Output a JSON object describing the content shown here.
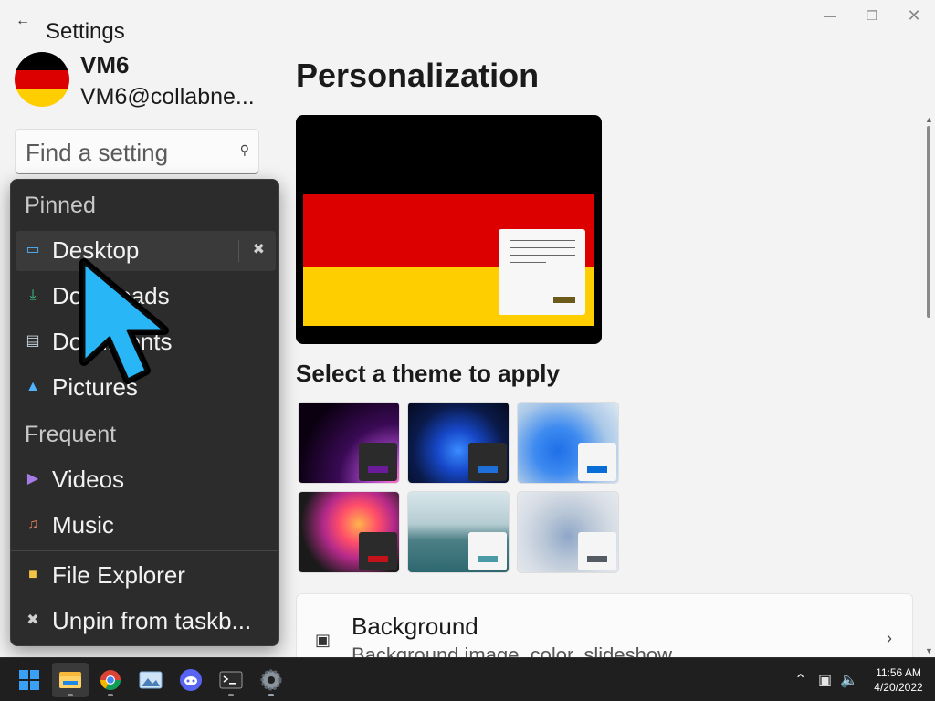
{
  "window": {
    "app_title": "Settings",
    "back_icon": "back-arrow-icon",
    "controls": [
      "minimize",
      "restore",
      "close"
    ]
  },
  "user": {
    "name": "VM6",
    "email": "VM6@collabne..."
  },
  "search": {
    "placeholder": "Find a setting"
  },
  "page": {
    "title": "Personalization",
    "theme_section_title": "Select a theme to apply",
    "themes": [
      {
        "name": "theme-1",
        "accent": "#6a1b9a"
      },
      {
        "name": "theme-2",
        "accent": "#1e6fd9"
      },
      {
        "name": "theme-3",
        "accent": "#0a6cd6"
      },
      {
        "name": "theme-4",
        "accent": "#c4121a"
      },
      {
        "name": "theme-5",
        "accent": "#4a9aa8"
      },
      {
        "name": "theme-6",
        "accent": "#555b63"
      }
    ],
    "background_card": {
      "title": "Background",
      "subtitle": "Background image, color, slideshow"
    }
  },
  "jump_list": {
    "pinned_header": "Pinned",
    "pinned": [
      {
        "label": "Desktop",
        "icon": "desktop-icon"
      },
      {
        "label": "Downloads",
        "icon": "download-icon"
      },
      {
        "label": "Documents",
        "icon": "document-icon"
      },
      {
        "label": "Pictures",
        "icon": "picture-icon"
      }
    ],
    "frequent_header": "Frequent",
    "frequent": [
      {
        "label": "Videos",
        "icon": "video-icon"
      },
      {
        "label": "Music",
        "icon": "music-icon"
      }
    ],
    "actions": [
      {
        "label": "File Explorer",
        "icon": "folder-icon"
      },
      {
        "label": "Unpin from taskb...",
        "icon": "unpin-icon"
      }
    ]
  },
  "taskbar": {
    "apps": [
      "start",
      "file-explorer",
      "chrome",
      "photos",
      "discord",
      "terminal",
      "settings"
    ],
    "clock": {
      "time": "11:56 AM",
      "date": "4/20/2022"
    }
  },
  "colors": {
    "flag_black": "#000000",
    "flag_red": "#dd0000",
    "flag_gold": "#ffce00",
    "cursor": "#29b6f6"
  }
}
